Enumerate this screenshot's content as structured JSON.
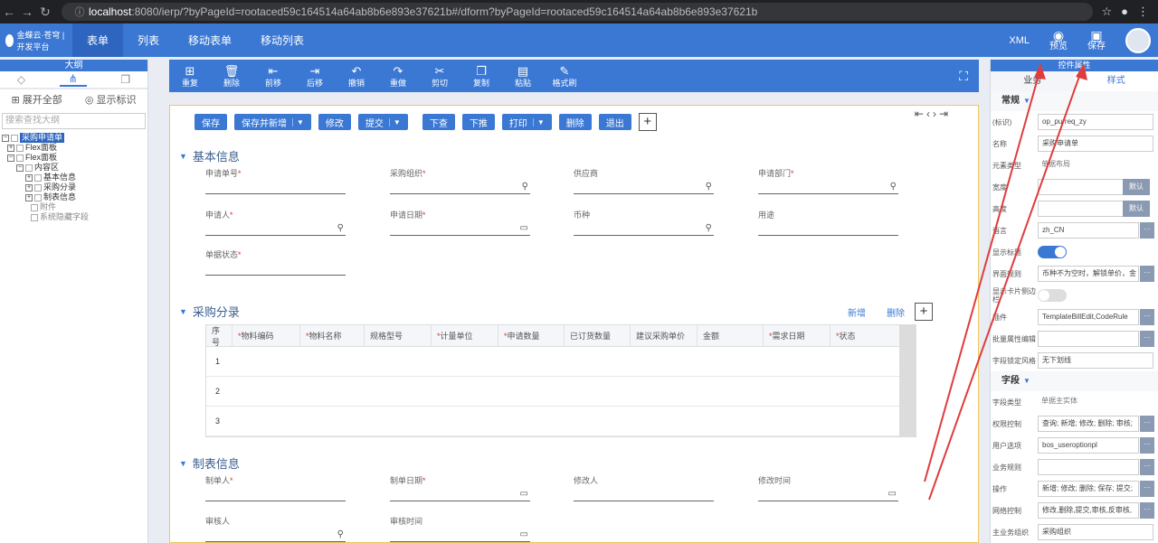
{
  "browser": {
    "url_host": "localhost",
    "url_rest": ":8080/ierp/?byPageId=rootaced59c164514a64ab8b6e893e37621b#/dform?byPageId=rootaced59c164514a64ab8b6e893e37621b"
  },
  "header": {
    "logo_text": "金蝶云·苍穹 | 开发平台",
    "tabs": [
      "表单",
      "列表",
      "移动表单",
      "移动列表"
    ],
    "xml_label": "XML",
    "preview_label": "预览",
    "save_label": "保存"
  },
  "left_panel": {
    "title": "大纲",
    "expand_all": "展开全部",
    "show_ids": "显示标识",
    "search_placeholder": "搜索查找大纲",
    "tree": {
      "root": "采购申请单",
      "flex1": "Flex面板",
      "flex2": "Flex面板",
      "content": "内容区",
      "basic": "基本信息",
      "purchase": "采购分录",
      "creator": "制表信息",
      "attach": "附件",
      "hidden": "系统隐藏字段"
    }
  },
  "toolbar": {
    "items": [
      "重复",
      "删除",
      "前移",
      "后移",
      "撤销",
      "重做",
      "剪切",
      "复制",
      "粘贴",
      "格式刷"
    ]
  },
  "form": {
    "actions": {
      "save": "保存",
      "save_new": "保存并新增",
      "modify": "修改",
      "submit": "提交",
      "down_query": "下查",
      "push": "下推",
      "print": "打印",
      "delete": "删除",
      "exit": "退出"
    },
    "basic_title": "基本信息",
    "fields": {
      "bill_no": "申请单号",
      "org": "采购组织",
      "supplier": "供应商",
      "dept": "申请部门",
      "applicant": "申请人",
      "apply_date": "申请日期",
      "currency": "币种",
      "usage": "用途",
      "status": "单据状态"
    },
    "entry_title": "采购分录",
    "entry_add": "新增",
    "entry_delete": "删除",
    "columns": {
      "seq": "序号",
      "mat_code": "物料编码",
      "mat_name": "物料名称",
      "spec": "规格型号",
      "unit": "计量单位",
      "qty": "申请数量",
      "ordered": "已订货数量",
      "price": "建议采购单价",
      "amount": "金额",
      "req_date": "需求日期",
      "state": "状态"
    },
    "rows": [
      "1",
      "2",
      "3"
    ],
    "creator_title": "制表信息",
    "creator_fields": {
      "creator": "制单人",
      "create_date": "制单日期",
      "modifier": "修改人",
      "modify_time": "修改时间",
      "auditor": "审核人",
      "audit_time": "审核时间"
    }
  },
  "right_panel": {
    "title": "控件属性",
    "tab_business": "业务",
    "tab_style": "样式",
    "group_general": "常规",
    "group_field": "字段",
    "props": {
      "id_label": "(标识)",
      "id_value": "op_purreq_zy",
      "name_label": "名称",
      "name_value": "采购申请单",
      "type_label": "元素类型",
      "type_value": "单据布局",
      "width_label": "宽度",
      "height_label": "高度",
      "default_label": "默认",
      "lang_label": "语言",
      "lang_value": "zh_CN",
      "show_title": "显示标题",
      "rules_label": "界面规则",
      "rules_value": "币种不为空时，解锁单价，金",
      "tabs_label": "显示卡片侧边栏",
      "plugin_label": "插件",
      "plugin_value": "TemplateBillEdit,CodeRule",
      "batch_label": "批量属性编辑",
      "lock_label": "字段锁定风格",
      "lock_value": "无下划线",
      "ftype_label": "字段类型",
      "ftype_value": "单据主实体",
      "perm_label": "权限控制",
      "perm_value": "查询; 新增; 修改; 删除; 审核;",
      "useropt_label": "用户选项",
      "useropt_value": "bos_useroptionpl",
      "bizrule_label": "业务规则",
      "op_label": "操作",
      "op_value": "新增; 修改; 删除; 保存; 提交;",
      "net_label": "网络控制",
      "net_value": "修改,删除,提交,审核,反审核,",
      "mainorg_label": "主业务组织",
      "mainorg_value": "采购组织"
    }
  },
  "colors": {
    "primary": "#3a78d4",
    "annotation": "#e03c3c"
  }
}
